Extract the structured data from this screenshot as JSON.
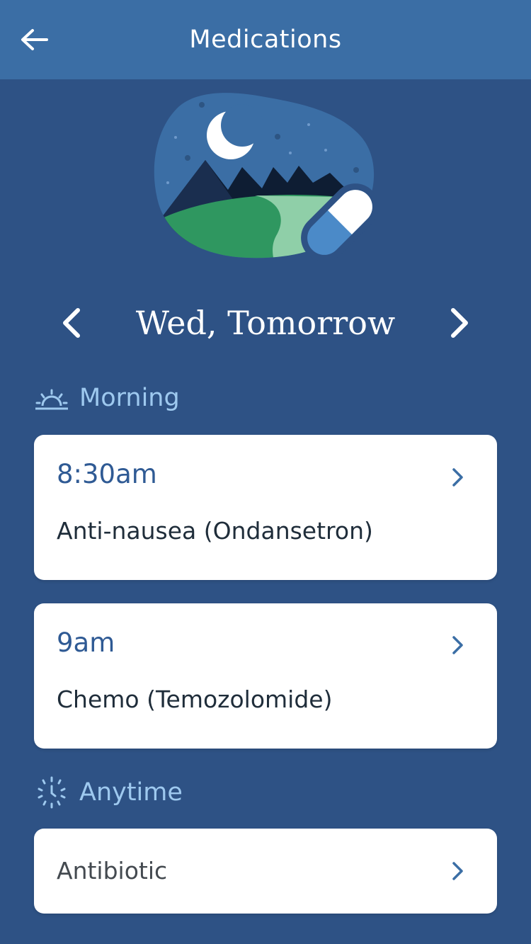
{
  "header": {
    "title": "Medications",
    "back_icon": "arrow-left-icon"
  },
  "illustration": {
    "icon": "night-landscape-pill-illustration"
  },
  "day_nav": {
    "title": "Wed, Tomorrow",
    "prev_icon": "chevron-left-icon",
    "next_icon": "chevron-right-icon"
  },
  "sections": [
    {
      "label": "Morning",
      "icon": "sunrise-icon",
      "items": [
        {
          "time": "8:30am",
          "name": "Anti-nausea (Ondansetron)"
        },
        {
          "time": "9am",
          "name": "Chemo (Temozolomide)"
        }
      ]
    },
    {
      "label": "Anytime",
      "icon": "dotted-clock-icon",
      "items": [
        {
          "name": "Antibiotic"
        }
      ]
    }
  ],
  "colors": {
    "header_bg": "#3b6ea5",
    "page_bg": "#2e5285",
    "section_label": "#9ec9ef",
    "time_text": "#2f5a94",
    "card_bg": "#ffffff"
  }
}
